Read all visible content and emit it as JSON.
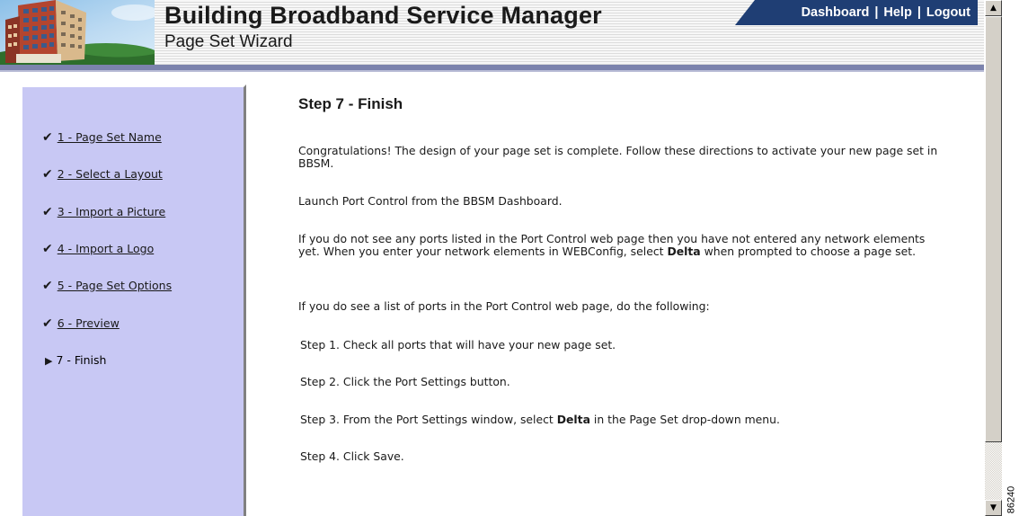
{
  "header": {
    "app_title": "Building Broadband Service Manager",
    "subtitle": "Page Set Wizard",
    "nav": {
      "dashboard": "Dashboard",
      "help": "Help",
      "logout": "Logout",
      "separator": "|"
    }
  },
  "sidebar": {
    "check_glyph": "✔",
    "current_glyph": "▶",
    "steps": [
      {
        "label": "1 - Page Set Name",
        "status": "completed"
      },
      {
        "label": "2 - Select a Layout",
        "status": "completed"
      },
      {
        "label": "3 - Import a Picture",
        "status": "completed"
      },
      {
        "label": "4 - Import a Logo",
        "status": "completed"
      },
      {
        "label": "5 - Page Set Options",
        "status": "completed"
      },
      {
        "label": "6 - Preview",
        "status": "completed"
      },
      {
        "label": "7 - Finish",
        "status": "current"
      }
    ]
  },
  "main": {
    "heading": "Step 7 - Finish",
    "congrats": "Congratulations! The design of your page set is complete. Follow these directions to activate your new page set in BBSM.",
    "launch": "Launch Port Control from the BBSM Dashboard.",
    "no_ports_before": "If you do not see any ports listed in the Port Control web page then you have not entered any network elements yet. When you enter your network elements in WEBConfig, select ",
    "no_ports_bold": "Delta",
    "no_ports_after": " when prompted to choose a page set.",
    "ports_intro": "If you do see a list of ports in the Port Control web page, do the following:",
    "step1": "Step 1. Check all ports that will have your new page set.",
    "step2": "Step 2. Click the Port Settings button.",
    "step3_before": "Step 3. From the Port Settings window, select ",
    "step3_bold": "Delta",
    "step3_after": " in the Page Set drop-down menu.",
    "step4": "Step 4. Click Save."
  },
  "scrollbar": {
    "up_glyph": "▲",
    "down_glyph": "▼"
  },
  "figure_id": "86240",
  "colors": {
    "sidebar_bg": "#c8c8f4",
    "nav_bg": "#1f3e74",
    "header_bar": "#7c83ad"
  }
}
